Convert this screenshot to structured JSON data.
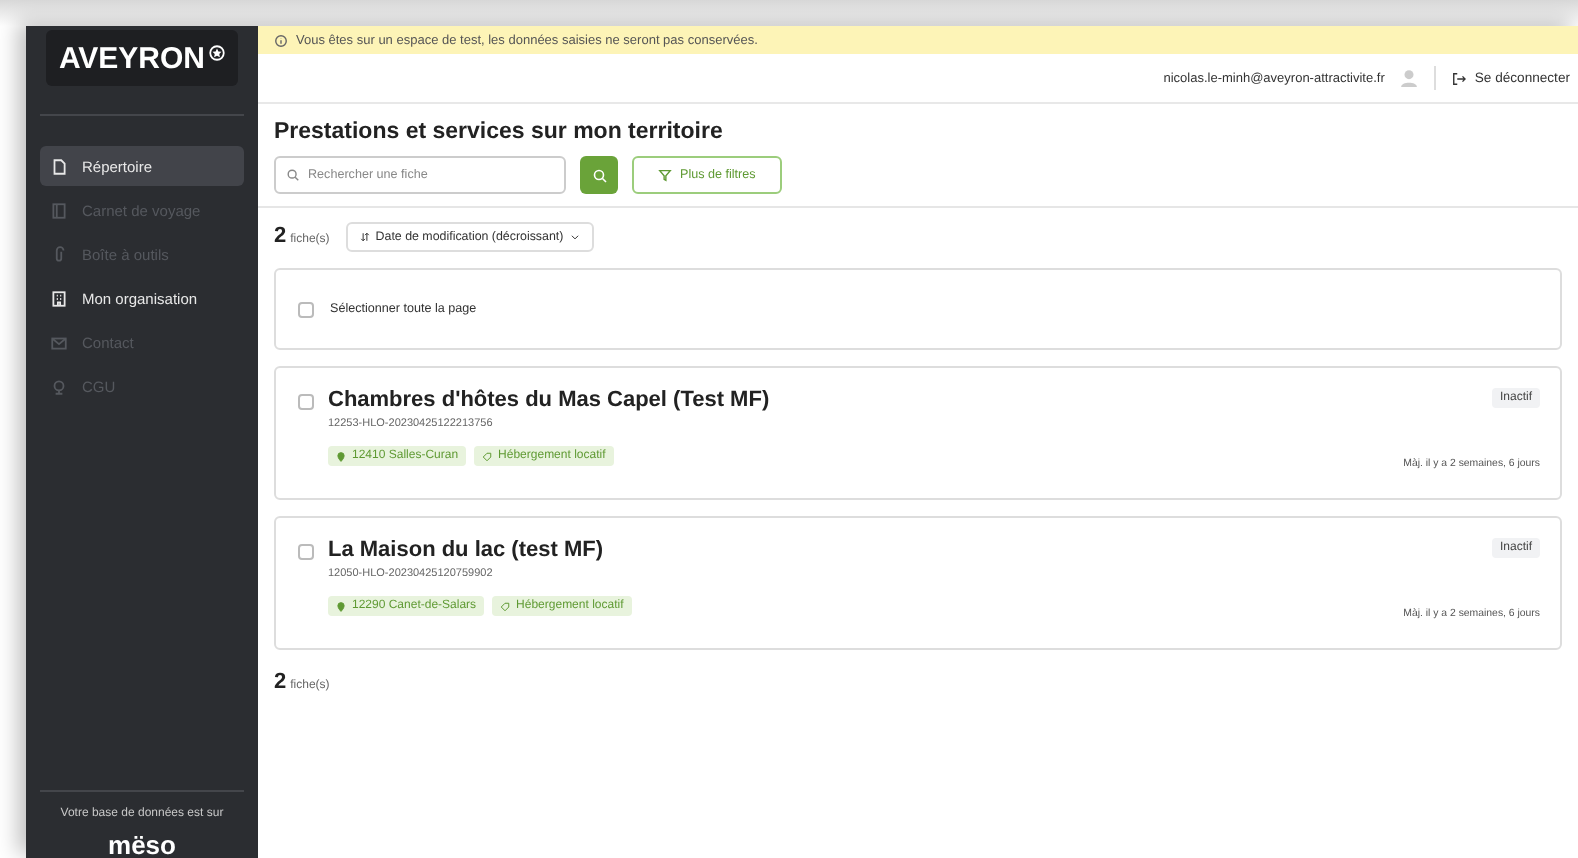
{
  "banner": {
    "text": "Vous êtes sur un espace de test, les données saisies ne seront pas conservées."
  },
  "sidebar": {
    "logo": "AVEYRON",
    "items": [
      {
        "label": "Répertoire",
        "kind": "file",
        "selected": true,
        "disabled": false
      },
      {
        "label": "Carnet de voyage",
        "kind": "book",
        "selected": false,
        "disabled": true
      },
      {
        "label": "Boîte à outils",
        "kind": "clip",
        "selected": false,
        "disabled": true
      },
      {
        "label": "Mon organisation",
        "kind": "building",
        "selected": false,
        "disabled": false
      },
      {
        "label": "Contact",
        "kind": "mail",
        "selected": false,
        "disabled": true
      },
      {
        "label": "CGU",
        "kind": "globe",
        "selected": false,
        "disabled": true
      }
    ],
    "footer_text": "Votre base de données est sur",
    "footer_logo": "mëso"
  },
  "header": {
    "email": "nicolas.le-minh@aveyron-attractivite.fr",
    "logout": "Se déconnecter"
  },
  "page": {
    "title": "Prestations et services sur mon territoire",
    "search": {
      "placeholder": "Rechercher une fiche"
    },
    "filters_button": "Plus de filtres",
    "count": "2",
    "count_unit": "fiche(s)",
    "sort": "Date de modification (décroissant)",
    "select_all": {
      "label": "Sélectionner toute la page",
      "checked": false
    },
    "records": [
      {
        "title": "Chambres d'hôtes du Mas Capel (Test MF)",
        "code": "12253-HLO-20230425122213756",
        "location": "12410 Salles-Curan",
        "category": "Hébergement locatif",
        "status": "Inactif",
        "updated": "Màj. il y a 2 semaines, 6 jours",
        "checked": false
      },
      {
        "title": "La Maison du lac (test MF)",
        "code": "12050-HLO-20230425120759902",
        "location": "12290 Canet-de-Salars",
        "category": "Hébergement locatif",
        "status": "Inactif",
        "updated": "Màj. il y a 2 semaines, 6 jours",
        "checked": false
      }
    ],
    "footer_count": "2",
    "footer_count_unit": "fiche(s)"
  }
}
